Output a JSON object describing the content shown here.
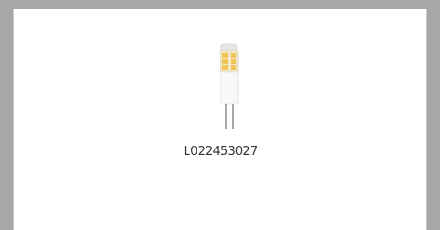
{
  "product": {
    "code": "L022453027",
    "image": "g4-led-capsule-bulb"
  },
  "colors": {
    "background": "#a8a8a8",
    "card": "#ffffff",
    "text": "#333333"
  }
}
